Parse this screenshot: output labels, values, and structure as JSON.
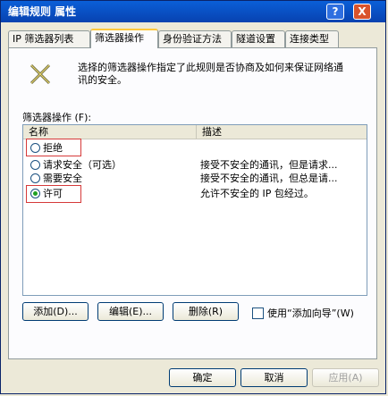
{
  "window": {
    "title": "编辑规则 属性"
  },
  "titlebar_buttons": {
    "help": "?",
    "close": "X"
  },
  "tabs": [
    {
      "label": "IP 筛选器列表",
      "active": false
    },
    {
      "label": "筛选器操作",
      "active": true
    },
    {
      "label": "身份验证方法",
      "active": false
    },
    {
      "label": "隧道设置",
      "active": false
    },
    {
      "label": "连接类型",
      "active": false
    }
  ],
  "description": "选择的筛选器操作指定了此规则是否协商及如何来保证网络通讯的安全。",
  "list": {
    "label": "筛选器操作 (F):",
    "columns": {
      "name": "名称",
      "desc": "描述"
    },
    "rows": [
      {
        "name": "拒绝",
        "desc": "",
        "checked": false
      },
      {
        "name": "请求安全（可选）",
        "desc": "接受不安全的通讯，但是请求...",
        "checked": false
      },
      {
        "name": "需要安全",
        "desc": "接受不安全的通讯，但总是请...",
        "checked": false
      },
      {
        "name": "许可",
        "desc": "允许不安全的 IP 包经过。",
        "checked": true
      }
    ]
  },
  "buttons": {
    "add": "添加(D)...",
    "edit": "编辑(E)...",
    "remove": "删除(R)",
    "wizard_label": "使用“添加向导”(W)",
    "ok": "确定",
    "cancel": "取消",
    "apply": "应用(A)"
  },
  "colors": {
    "titlebar": "#0842b0",
    "highlight": "#d63a3a",
    "selected_radio": "#21a121"
  }
}
